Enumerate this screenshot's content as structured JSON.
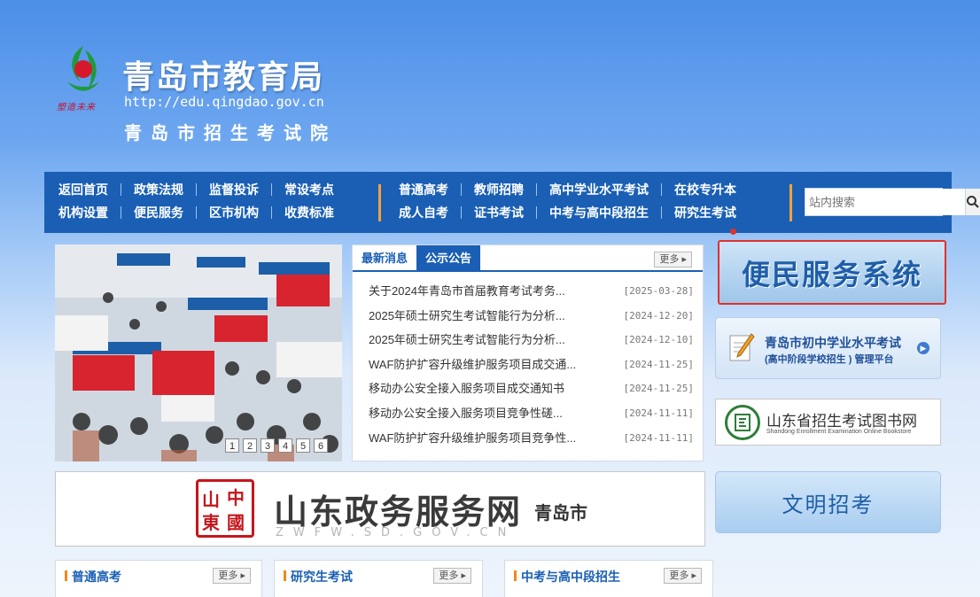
{
  "header": {
    "title": "青岛市教育局",
    "url": "http://edu.qingdao.gov.cn",
    "subtitle": "青岛市招生考试院",
    "motto": "塑造未来"
  },
  "nav": {
    "group1_row1": [
      "返回首页",
      "政策法规",
      "监督投诉",
      "常设考点"
    ],
    "group1_row2": [
      "机构设置",
      "便民服务",
      "区市机构",
      "收费标准"
    ],
    "group2_row1": [
      "普通高考",
      "教师招聘",
      "高中学业水平考试",
      "在校专升本"
    ],
    "group2_row2": [
      "成人自考",
      "证书考试",
      "中考与高中段招生",
      "研究生考试"
    ],
    "search_placeholder": "站内搜索"
  },
  "carousel": {
    "dots": [
      "1",
      "2",
      "3",
      "4",
      "5",
      "6"
    ],
    "active": 1
  },
  "news": {
    "tabs": [
      "最新消息",
      "公示公告"
    ],
    "active_tab": 1,
    "more": "更多",
    "items": [
      {
        "title": "关于2024年青岛市首届教育考试考务...",
        "date": "[2025-03-28]"
      },
      {
        "title": "2025年硕士研究生考试智能行为分析...",
        "date": "[2024-12-20]"
      },
      {
        "title": "2025年硕士研究生考试智能行为分析...",
        "date": "[2024-12-10]"
      },
      {
        "title": "WAF防护扩容升级维护服务项目成交通...",
        "date": "[2024-11-25]"
      },
      {
        "title": "移动办公安全接入服务项目成交通知书",
        "date": "[2024-11-25]"
      },
      {
        "title": "移动办公安全接入服务项目竞争性磋...",
        "date": "[2024-11-11]"
      },
      {
        "title": "WAF防护扩容升级维护服务项目竞争性...",
        "date": "[2024-11-11]"
      }
    ]
  },
  "side": {
    "service_banner": "便民服务系统",
    "exam_line1": "青岛市初中学业水平考试",
    "exam_line2": "(高中阶段学校招生 ) 管理平台",
    "book_title": "山东省招生考试图书网",
    "book_sub": "Shandong Enrollment Examination Online Bookstore",
    "wenming": "文明招考"
  },
  "gov": {
    "seal": [
      "中",
      "國",
      "山",
      "東"
    ],
    "title": "山东政务服务网",
    "url": "ZWFW.SD.GOV.CN",
    "city": "青岛市"
  },
  "sections": [
    {
      "title": "普通高考",
      "more": "更多"
    },
    {
      "title": "研究生考试",
      "more": "更多"
    },
    {
      "title": "中考与高中段招生",
      "more": "更多"
    }
  ],
  "colors": {
    "nav_bg": "#1a5fb4",
    "accent_orange": "#f2a23c",
    "highlight_red": "#e0312b"
  }
}
